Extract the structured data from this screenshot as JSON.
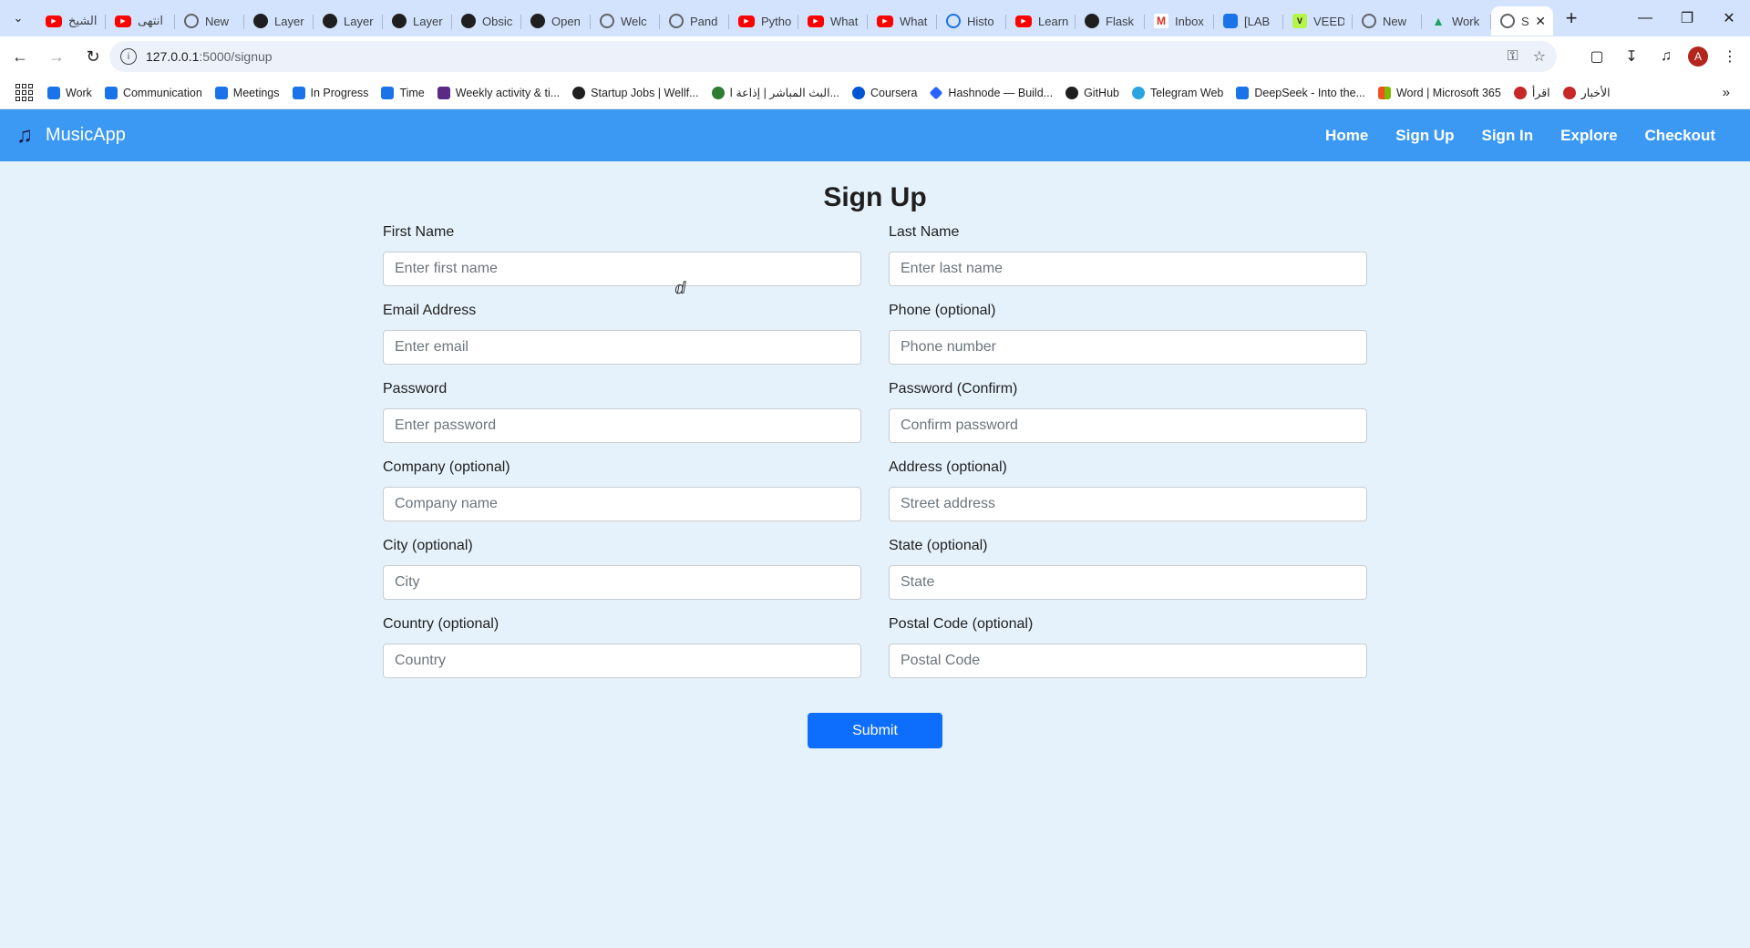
{
  "browser": {
    "tabs": [
      {
        "label": "الشيخ",
        "icon": "youtube-icon"
      },
      {
        "label": "انتهى",
        "icon": "youtube-icon"
      },
      {
        "label": "New",
        "icon": "globe-icon"
      },
      {
        "label": "Layer",
        "icon": "openai-icon"
      },
      {
        "label": "Layer",
        "icon": "openai-icon"
      },
      {
        "label": "Layer",
        "icon": "openai-icon"
      },
      {
        "label": "Obsic",
        "icon": "openai-icon"
      },
      {
        "label": "Open",
        "icon": "openai-icon"
      },
      {
        "label": "Welc",
        "icon": "globe-icon"
      },
      {
        "label": "Pand",
        "icon": "globe-icon"
      },
      {
        "label": "Pytho",
        "icon": "youtube-icon"
      },
      {
        "label": "What",
        "icon": "youtube-icon"
      },
      {
        "label": "What",
        "icon": "youtube-icon"
      },
      {
        "label": "Histo",
        "icon": "history-icon"
      },
      {
        "label": "Learn",
        "icon": "youtube-icon"
      },
      {
        "label": "Flask",
        "icon": "github-icon"
      },
      {
        "label": "Inbox",
        "icon": "gmail-icon"
      },
      {
        "label": "[LAB",
        "icon": "jira-icon"
      },
      {
        "label": "VEED",
        "icon": "veed-icon"
      },
      {
        "label": "New",
        "icon": "globe-icon"
      },
      {
        "label": "Work",
        "icon": "drive-icon"
      },
      {
        "label": "S",
        "icon": "globe-icon",
        "active": true
      }
    ],
    "url_host": "127.0.0.1",
    "url_path": ":5000/signup",
    "bookmarks": [
      {
        "label": "Work",
        "icon": "jira-icon"
      },
      {
        "label": "Communication",
        "icon": "jira-icon"
      },
      {
        "label": "Meetings",
        "icon": "jira-icon"
      },
      {
        "label": "In Progress",
        "icon": "jira-icon"
      },
      {
        "label": "Time",
        "icon": "jira-icon"
      },
      {
        "label": "Weekly activity & ti...",
        "icon": "calendar-icon"
      },
      {
        "label": "Startup Jobs | Wellf...",
        "icon": "wellfound-icon"
      },
      {
        "label": "البث المباشر | إذاعة ا...",
        "icon": "radio-icon"
      },
      {
        "label": "Coursera",
        "icon": "coursera-icon"
      },
      {
        "label": "Hashnode — Build...",
        "icon": "hashnode-icon"
      },
      {
        "label": "GitHub",
        "icon": "github-icon"
      },
      {
        "label": "Telegram Web",
        "icon": "telegram-icon"
      },
      {
        "label": "DeepSeek - Into the...",
        "icon": "deepseek-icon"
      },
      {
        "label": "Word | Microsoft 365",
        "icon": "microsoft-icon"
      },
      {
        "label": "اقرأ",
        "icon": "iqraa-icon"
      },
      {
        "label": "الأخبار",
        "icon": "news-icon"
      }
    ]
  },
  "app": {
    "brand": "MusicApp",
    "nav": [
      "Home",
      "Sign Up",
      "Sign In",
      "Explore",
      "Checkout"
    ],
    "title": "Sign Up",
    "fields": [
      {
        "label": "First Name",
        "placeholder": "Enter first name",
        "value": ""
      },
      {
        "label": "Last Name",
        "placeholder": "Enter last name",
        "value": ""
      },
      {
        "label": "Email Address",
        "placeholder": "Enter email",
        "value": ""
      },
      {
        "label": "Phone (optional)",
        "placeholder": "Phone number",
        "value": ""
      },
      {
        "label": "Password",
        "placeholder": "Enter password",
        "value": ""
      },
      {
        "label": "Password (Confirm)",
        "placeholder": "Confirm password",
        "value": ""
      },
      {
        "label": "Company (optional)",
        "placeholder": "Company name",
        "value": ""
      },
      {
        "label": "Address (optional)",
        "placeholder": "Street address",
        "value": ""
      },
      {
        "label": "City (optional)",
        "placeholder": "City",
        "value": ""
      },
      {
        "label": "State (optional)",
        "placeholder": "State",
        "value": ""
      },
      {
        "label": "Country (optional)",
        "placeholder": "Country",
        "value": ""
      },
      {
        "label": "Postal Code (optional)",
        "placeholder": "Postal Code",
        "value": ""
      }
    ],
    "submit": "Submit"
  },
  "colors": {
    "navbar": "#3b99f3",
    "page_bg": "#e6f2fb",
    "submit_bg": "#0d6efd"
  }
}
